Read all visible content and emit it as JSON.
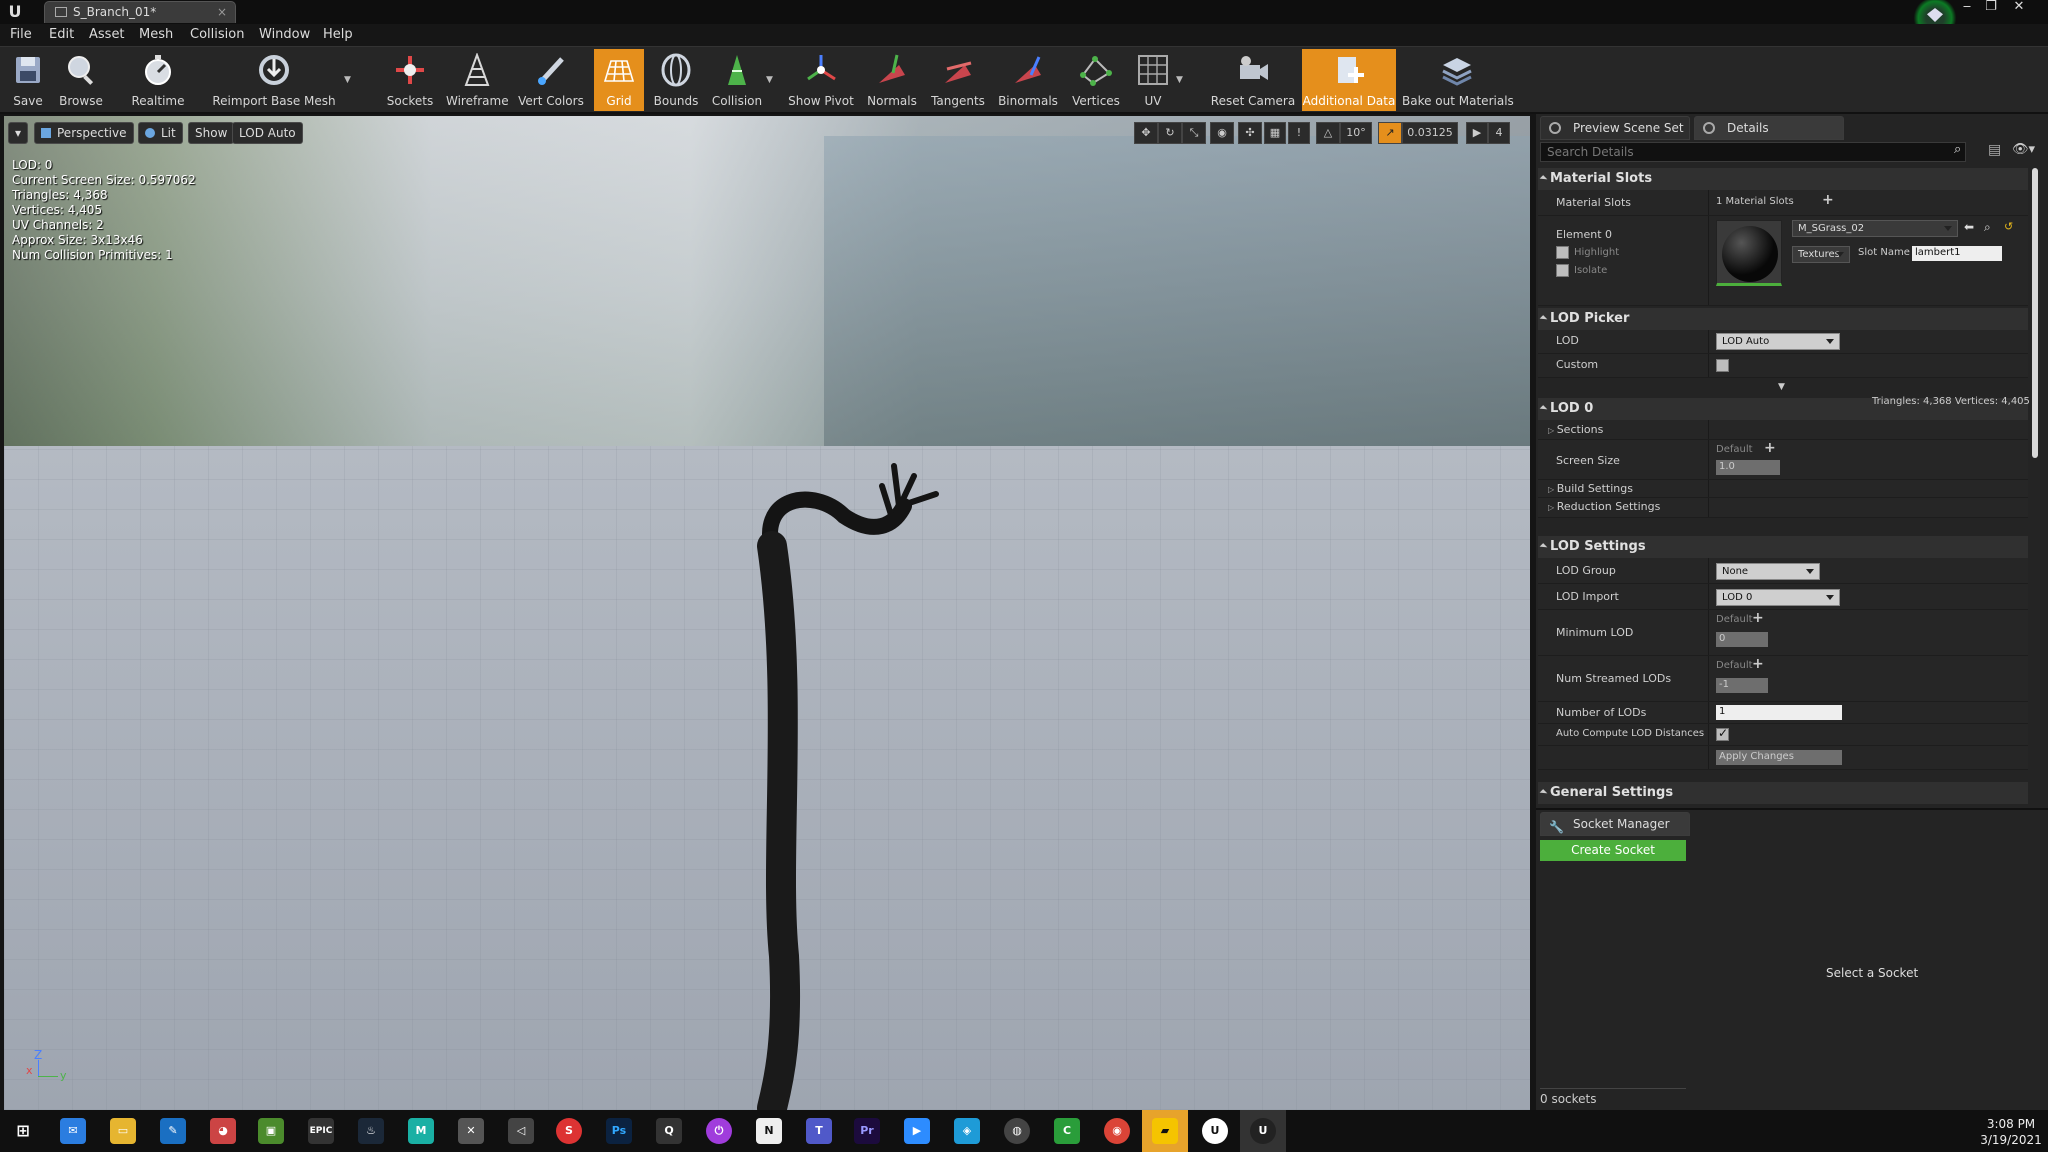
{
  "window": {
    "tab_title": "S_Branch_01*",
    "tab_close": "×",
    "min": "‒",
    "max": "❐",
    "close": "✕"
  },
  "menu": [
    "File",
    "Edit",
    "Asset",
    "Mesh",
    "Collision",
    "Window",
    "Help"
  ],
  "toolbar": [
    {
      "label": "Save",
      "icon": "save-icon"
    },
    {
      "label": "Browse",
      "icon": "browse-icon"
    },
    {
      "label": "Realtime",
      "icon": "realtime-icon"
    },
    {
      "label": "Reimport Base Mesh",
      "icon": "reimport-icon"
    },
    {
      "label": "Sockets",
      "icon": "sockets-icon"
    },
    {
      "label": "Wireframe",
      "icon": "wireframe-icon"
    },
    {
      "label": "Vert Colors",
      "icon": "vert-colors-icon"
    },
    {
      "label": "Grid",
      "icon": "grid-icon",
      "active": true
    },
    {
      "label": "Bounds",
      "icon": "bounds-icon"
    },
    {
      "label": "Collision",
      "icon": "collision-icon"
    },
    {
      "label": "Show Pivot",
      "icon": "pivot-icon"
    },
    {
      "label": "Normals",
      "icon": "normals-icon"
    },
    {
      "label": "Tangents",
      "icon": "tangents-icon"
    },
    {
      "label": "Binormals",
      "icon": "binormals-icon"
    },
    {
      "label": "Vertices",
      "icon": "vertices-icon"
    },
    {
      "label": "UV",
      "icon": "uv-icon"
    },
    {
      "label": "Reset Camera",
      "icon": "camera-icon"
    },
    {
      "label": "Additional Data",
      "icon": "additional-data-icon",
      "active": true
    },
    {
      "label": "Bake out Materials",
      "icon": "bake-icon"
    }
  ],
  "viewport": {
    "buttons": {
      "perspective": "Perspective",
      "lit": "Lit",
      "show": "Show",
      "lod": "LOD Auto"
    },
    "stats": [
      "LOD:  0",
      "Current Screen Size:  0.597062",
      "Triangles:  4,368",
      "Vertices:  4,405",
      "UV Channels:  2",
      "Approx Size: 3x13x46",
      "Num Collision Primitives:  1"
    ],
    "snap_angle": "10°",
    "snap_scale": "0.03125",
    "camera_speed": "4",
    "axis": {
      "z": "Z",
      "x": "x",
      "y": "y"
    }
  },
  "details": {
    "tabs": [
      "Preview Scene Set",
      "Details"
    ],
    "search_placeholder": "Search Details",
    "material_slots": {
      "title": "Material Slots",
      "label": "Material Slots",
      "count": "1 Material Slots",
      "element": "Element 0",
      "highlight": "Highlight",
      "isolate": "Isolate",
      "material": "M_SGrass_02",
      "textures": "Textures",
      "slot_name_label": "Slot Name",
      "slot_name": "lambert1"
    },
    "lod_picker": {
      "title": "LOD Picker",
      "lod_label": "LOD",
      "lod_value": "LOD Auto",
      "custom_label": "Custom"
    },
    "lod0": {
      "title": "LOD 0",
      "stats": "Triangles: 4,368   Vertices: 4,405",
      "sections": "Sections",
      "screen_size": "Screen Size",
      "default": "Default",
      "screen_size_value": "1.0",
      "build": "Build Settings",
      "reduction": "Reduction Settings"
    },
    "lod_settings": {
      "title": "LOD Settings",
      "group_label": "LOD Group",
      "group_value": "None",
      "import_label": "LOD Import",
      "import_value": "LOD 0",
      "min_lod": "Minimum LOD",
      "default": "Default",
      "min_lod_value": "0",
      "streamed": "Num Streamed LODs",
      "streamed_value": "-1",
      "num_lods": "Number of LODs",
      "num_lods_value": "1",
      "auto_compute": "Auto Compute LOD Distances",
      "apply": "Apply Changes"
    },
    "general": {
      "title": "General Settings"
    }
  },
  "socket_manager": {
    "tab": "Socket Manager",
    "create": "Create Socket",
    "select": "Select a Socket",
    "count": "0 sockets"
  },
  "taskbar": {
    "time": "3:08 PM",
    "date": "3/19/2021"
  }
}
